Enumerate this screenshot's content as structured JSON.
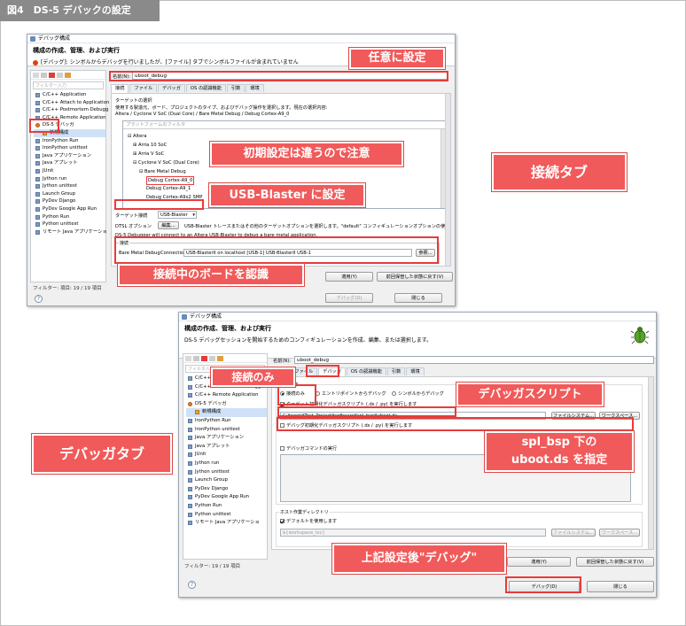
{
  "figure_title": "図4　DS-5 デバックの設定",
  "win1": {
    "title": "デバッグ構成",
    "header_title": "構成の作成、管理、および実行",
    "header_msg": "[デバッグ]: シンボルからデバッグを行いましたが、[ファイル] タブでシンボルファイルが含まれていません",
    "filter_placeholder": "フィルター入力",
    "tree": [
      "C/C++ Application",
      "C/C++ Attach to Application",
      "C/C++ Postmortem Debugg",
      "C/C++ Remote Application",
      "DS-5 デバッガ",
      "新規構成",
      "IronPython Run",
      "IronPython unittest",
      "Java アプリケーション",
      "Java アプレット",
      "JUnit",
      "Jython run",
      "Jython unittest",
      "Launch Group",
      "PyDev Django",
      "PyDev Google App Run",
      "Python Run",
      "Python unittest",
      "リモート Java アプリケーショ"
    ],
    "filter_count": "フィルター: 項目: 19 / 19 項目",
    "name_label": "名前(N):",
    "name_value": "uboot_debug",
    "tabs": [
      "接続",
      "ファイル",
      "デバッガ",
      "OS の認識機能",
      "引数",
      "環境"
    ],
    "target_group": "ターゲットの選択",
    "target_desc": "使用する製造元、ボード、プロジェクトのタイプ、およびデバッグ操作を選択します。現在の選択内容:",
    "target_current": "Altera / Cyclone V SoC (Dual Core) / Bare Metal Debug / Debug Cortex-A9_0",
    "platform_filter": "プラットフォームのフィルタ",
    "platform_tree": [
      "Altera",
      "Arria 10 SoC",
      "Arria V SoC",
      "Cyclone V SoC (Dual Core)",
      "Bare Metal Debug",
      "Debug Cortex-A9_0",
      "Debug Cortex-A9_1",
      "Debug Cortex-A9x2 SMP"
    ],
    "target_conn_label": "ターゲット接続",
    "target_conn_value": "USB-Blaster",
    "dtsl_label": "DTSL オプション",
    "dtsl_button": "編集...",
    "dtsl_desc": "USB-Blaster トレースまたはその他のターゲットオプションを選択します。\"default\" コンフィギュレーションオプションの使用",
    "ds5_desc": "DS-5 Debugger will connect to an Altera USB-Blaster to debug a bare metal application.",
    "connection_group": "接続",
    "bare_metal_label": "Bare Metal Debug",
    "connection_label": "Connection",
    "connection_value": "USB-BlasterII on localhost [USB-1] USB-BlasterII USB-1",
    "browse_button": "参照...",
    "apply_button": "適用(Y)",
    "revert_button": "前回保管した状態に戻す(V)",
    "debug_button": "デバッグ(D)",
    "close_button": "閉じる"
  },
  "win2": {
    "title": "デバッグ構成",
    "header_title": "構成の作成、管理、および実行",
    "header_msg": "DS-5 デバッグセッションを開始するためのコンフィギュレーションを作成、編集、または選択します。",
    "filter_placeholder": "フィルタ入力",
    "tree": [
      "C/C++ Attach to Application",
      "C/C++ Postmortem Debugg",
      "C/C++ Remote Application",
      "DS-5 デバッガ",
      "新規構成",
      "IronPython Run",
      "IronPython unittest",
      "Java アプリケーション",
      "Java アプレット",
      "JUnit",
      "Jython run",
      "Jython unittest",
      "Launch Group",
      "PyDev Django",
      "PyDev Google App Run",
      "Python Run",
      "Python unittest",
      "リモート Java アプリケーショ"
    ],
    "filter_count": "フィルター: 19 / 19 項目",
    "name_label": "名前(N):",
    "name_value": "uboot_debug",
    "tabs": [
      "接続",
      "ファイル",
      "デバッガ",
      "OS の認識機能",
      "引数",
      "環境"
    ],
    "run_control": "実行制御",
    "radio_connect_only": "接続のみ",
    "radio_entry_point": "エントリポイントからデバッグ",
    "radio_symbol": "シンボルからデバッグ",
    "script_check": "ターゲット初期化デバッガスクリプト (.ds / .py) を実行します",
    "script_path": "C:¥work¥Test_Project¥software¥spl_bsp¥uboot.ds",
    "filesystem_button": "ファイルシステム...",
    "workspace_button": "ワークスペース...",
    "debug_init_check": "デバッグ初期化デバッガスクリプト (.ds / .py) を実行します",
    "debugger_cmd_check": "デバッガコマンドの実行",
    "host_dir_group": "ホスト作業ディレクトリ",
    "use_default_check": "デフォルトを使用します",
    "host_dir_value": "${workspace_loc}",
    "apply_button": "適用(Y)",
    "revert_button": "前回保管した状態に戻す(V)",
    "debug_button": "デバッグ(D)",
    "close_button": "閉じる"
  },
  "callouts": {
    "any_setting": "任意に設定",
    "initial_differs": "初期設定は違うので注意",
    "usb_blaster": "USB-Blaster に設定",
    "recognize_board": "接続中のボードを認識",
    "connect_tab": "接続タブ",
    "connect_only": "接続のみ",
    "debugger_script": "デバッガスクリプト",
    "spl_bsp_1": "spl_bsp 下の",
    "spl_bsp_2": "uboot.ds を指定",
    "debugger_tab": "デバッガタブ",
    "after_setting": "上記設定後\"デバッグ\""
  }
}
